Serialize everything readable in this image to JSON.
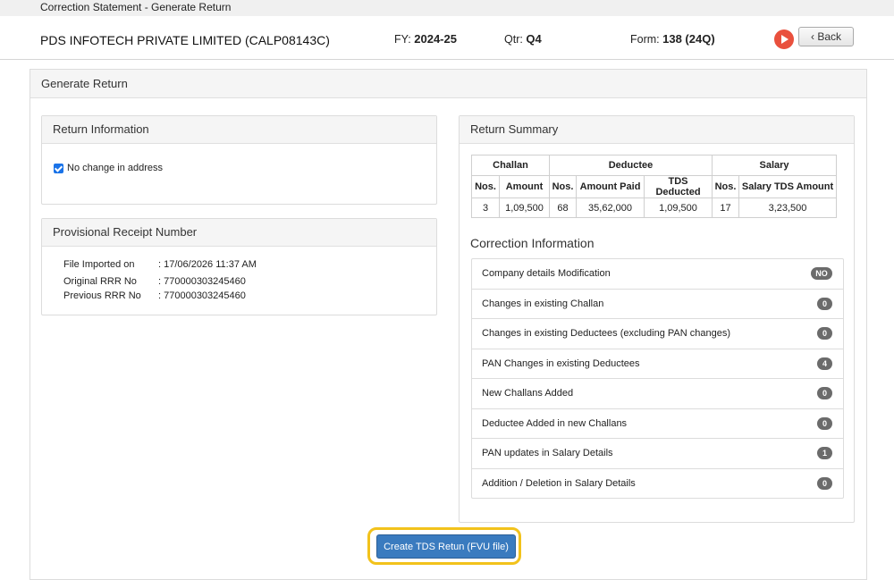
{
  "window": {
    "title": "Correction Statement - Generate Return"
  },
  "header": {
    "company": "PDS INFOTECH PRIVATE LIMITED (CALP08143C)",
    "fy_label": "FY:",
    "fy_value": "2024-25",
    "qtr_label": "Qtr:",
    "qtr_value": "Q4",
    "form_label": "Form:",
    "form_value": "138 (24Q)",
    "back_label": "Back"
  },
  "main": {
    "title": "Generate Return"
  },
  "return_info": {
    "title": "Return Information",
    "no_change_address": "No change in address",
    "checked": true
  },
  "receipt": {
    "title": "Provisional Receipt Number",
    "rows": [
      {
        "label": "File Imported on",
        "value": ": 17/06/2026 11:37 AM"
      },
      {
        "label": "Original RRR No",
        "value": ": 770000303245460"
      },
      {
        "label": "Previous RRR No",
        "value": ": 770000303245460"
      }
    ]
  },
  "summary": {
    "title": "Return Summary",
    "groups": [
      "Challan",
      "Deductee",
      "Salary"
    ],
    "columns": [
      "Nos.",
      "Amount",
      "Nos.",
      "Amount Paid",
      "TDS Deducted",
      "Nos.",
      "Salary TDS Amount"
    ],
    "values": [
      "3",
      "1,09,500",
      "68",
      "35,62,000",
      "1,09,500",
      "17",
      "3,23,500"
    ]
  },
  "correction": {
    "title": "Correction Information",
    "items": [
      {
        "label": "Company details Modification",
        "badge": "NO"
      },
      {
        "label": "Changes in existing Challan",
        "badge": "0"
      },
      {
        "label": "Changes in existing Deductees (excluding PAN changes)",
        "badge": "0"
      },
      {
        "label": "PAN Changes in existing Deductees",
        "badge": "4"
      },
      {
        "label": "New Challans Added",
        "badge": "0"
      },
      {
        "label": "Deductee Added in new Challans",
        "badge": "0"
      },
      {
        "label": "PAN updates in Salary Details",
        "badge": "1"
      },
      {
        "label": "Addition / Deletion in Salary Details",
        "badge": "0"
      }
    ]
  },
  "actions": {
    "create_label": "Create TDS Retun (FVU file)"
  },
  "colors": {
    "accent": "#3a7bbf",
    "highlight": "#f2c21b",
    "play": "#e9503d"
  }
}
